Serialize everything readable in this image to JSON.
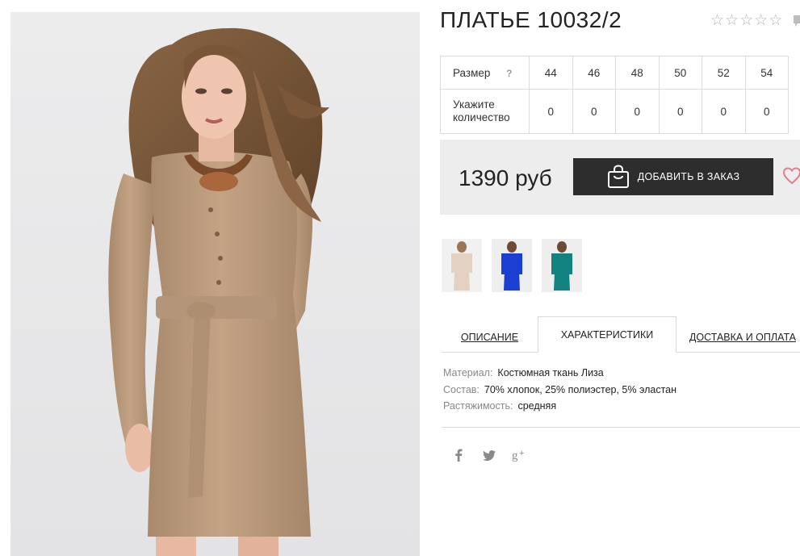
{
  "product": {
    "title": "ПЛАТЬЕ 10032/2",
    "rating_stars": 5,
    "rating_filled": 0
  },
  "size_table": {
    "size_label": "Размер",
    "help_icon": "?",
    "qty_label_line1": "Укажите",
    "qty_label_line2": "количество",
    "sizes": [
      "44",
      "46",
      "48",
      "50",
      "52",
      "54"
    ],
    "quantities": [
      "0",
      "0",
      "0",
      "0",
      "0",
      "0"
    ]
  },
  "purchase": {
    "price": "1390 руб",
    "add_button": "ДОБАВИТЬ В ЗАКАЗ",
    "bag_icon": "shopping-bag-icon",
    "wishlist_icon": "heart-icon"
  },
  "thumbnails": [
    {
      "color_name": "beige",
      "color": "#e3d2c2"
    },
    {
      "color_name": "blue",
      "color": "#1b3fd0"
    },
    {
      "color_name": "teal",
      "color": "#13837f"
    }
  ],
  "tabs": [
    {
      "label": "ОПИСАНИЕ",
      "active": false
    },
    {
      "label": "ХАРАКТЕРИСТИКИ",
      "active": true
    },
    {
      "label": "ДОСТАВКА И ОПЛАТА",
      "active": false
    }
  ],
  "specs": [
    {
      "key": "Материал:",
      "value": "Костюмная ткань Лиза"
    },
    {
      "key": "Состав:",
      "value": "70% хлопок, 25% полиэстер, 5% эластан"
    },
    {
      "key": "Растяжимость:",
      "value": "средняя"
    }
  ],
  "social": [
    "facebook-icon",
    "twitter-icon",
    "google-plus-icon"
  ],
  "colors": {
    "button_bg": "#2d2d2d",
    "price_panel_bg": "#ededed",
    "dress_main": "#c19f80",
    "heart": "#e0808a"
  }
}
